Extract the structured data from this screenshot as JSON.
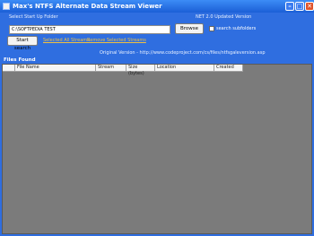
{
  "window": {
    "title": "Max's NTFS Alternate Data Stream Viewer",
    "min_glyph": "–",
    "max_glyph": "□",
    "close_glyph": "✕"
  },
  "top": {
    "select_label": "Select Start Up Folder",
    "version_note": "NET 2.0 Updated Version",
    "folder_value": "C:\\SOFTPEDIA TEST",
    "browse_label": "Browse",
    "subfolders_label": "search subfolders",
    "start_label": "Start search",
    "link_selected": "Selected All Streams",
    "link_remove": "Remove Selected Streams",
    "original_version": "Original Version - http://www.codeproject.com/cs/files/ntfsgaleversion.asp"
  },
  "files": {
    "header": "Files Found",
    "columns": [
      "File Name",
      "Stream",
      "Size (bytes)",
      "Location",
      "Created"
    ]
  },
  "colors": {
    "window_blue": "#2f6ee0",
    "list_bg": "#7b7b7b",
    "link": "#f0c040"
  }
}
